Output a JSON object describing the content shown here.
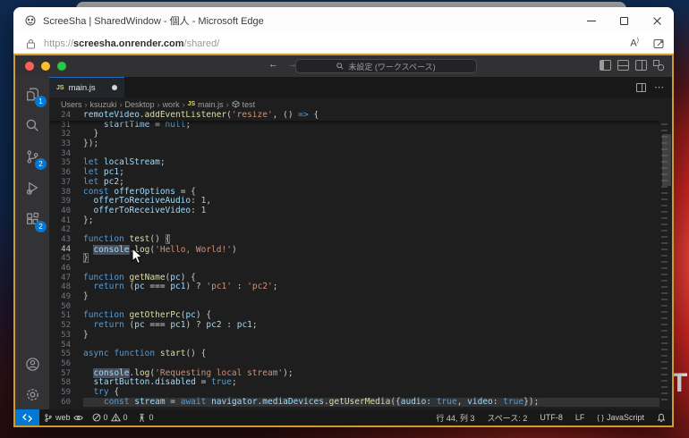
{
  "desktop": {
    "wallpaper_text": "TI"
  },
  "browser": {
    "title": "ScreeSha | SharedWindow - 個人 - Microsoft Edge",
    "url": {
      "protocol": "https://",
      "host": "screesha.onrender.com",
      "path": "/shared/"
    },
    "read_aloud_label": "A"
  },
  "vscode": {
    "traffic_colors": {
      "close": "#ff5f57",
      "minimize": "#febc2e",
      "zoom": "#28c840"
    },
    "command_center": {
      "label": "未設定 (ワークスペース)"
    },
    "tab": {
      "label": "main.js",
      "file_type": "JS"
    },
    "breadcrumb": [
      "Users",
      "ksuzuki",
      "Desktop",
      "work",
      "main.js",
      "test"
    ],
    "breadcrumb_separator": "›",
    "activity_badges": {
      "explorer": "1",
      "source_control": "2",
      "extensions": "2"
    },
    "sticky": {
      "n": "24",
      "t": [
        [
          "v",
          "remoteVideo"
        ],
        [
          "d",
          "."
        ],
        [
          "f",
          "addEventListener"
        ],
        [
          "d",
          "("
        ],
        [
          "s",
          "'resize'"
        ],
        [
          "d",
          ", () "
        ],
        [
          "k",
          "=>"
        ],
        [
          "d",
          " {"
        ]
      ]
    },
    "lines": [
      {
        "n": "31",
        "t": [
          [
            "d",
            "    "
          ],
          [
            "v",
            "startTime"
          ],
          [
            "d",
            " = "
          ],
          [
            "k",
            "null"
          ],
          [
            "d",
            ";"
          ]
        ]
      },
      {
        "n": "32",
        "t": [
          [
            "d",
            "  }"
          ]
        ]
      },
      {
        "n": "33",
        "t": [
          [
            "d",
            "});"
          ]
        ]
      },
      {
        "n": "34",
        "t": []
      },
      {
        "n": "35",
        "t": [
          [
            "k",
            "let"
          ],
          [
            "d",
            " "
          ],
          [
            "v",
            "localStream"
          ],
          [
            "d",
            ";"
          ]
        ]
      },
      {
        "n": "36",
        "t": [
          [
            "k",
            "let"
          ],
          [
            "d",
            " "
          ],
          [
            "v",
            "pc1"
          ],
          [
            "d",
            ";"
          ]
        ]
      },
      {
        "n": "37",
        "t": [
          [
            "k",
            "let"
          ],
          [
            "d",
            " "
          ],
          [
            "v",
            "pc2"
          ],
          [
            "d",
            ";"
          ]
        ]
      },
      {
        "n": "38",
        "t": [
          [
            "k",
            "const"
          ],
          [
            "d",
            " "
          ],
          [
            "v",
            "offerOptions"
          ],
          [
            "d",
            " = {"
          ]
        ]
      },
      {
        "n": "39",
        "t": [
          [
            "d",
            "  "
          ],
          [
            "v",
            "offerToReceiveAudio"
          ],
          [
            "d",
            ": "
          ],
          [
            "n",
            "1"
          ],
          [
            "d",
            ","
          ]
        ]
      },
      {
        "n": "40",
        "t": [
          [
            "d",
            "  "
          ],
          [
            "v",
            "offerToReceiveVideo"
          ],
          [
            "d",
            ": "
          ],
          [
            "n",
            "1"
          ]
        ]
      },
      {
        "n": "41",
        "t": [
          [
            "d",
            "};"
          ]
        ]
      },
      {
        "n": "42",
        "t": []
      },
      {
        "n": "43",
        "t": [
          [
            "k",
            "function"
          ],
          [
            "d",
            " "
          ],
          [
            "f",
            "test"
          ],
          [
            "d",
            "() "
          ],
          [
            "bm",
            "{"
          ]
        ]
      },
      {
        "n": "44",
        "active": true,
        "t": [
          [
            "d",
            "  "
          ],
          [
            "c",
            ""
          ],
          [
            "w",
            "console"
          ],
          [
            "d",
            "."
          ],
          [
            "f",
            "log"
          ],
          [
            "d",
            "("
          ],
          [
            "s",
            "'Hello, World!'"
          ],
          [
            "d",
            ")"
          ]
        ]
      },
      {
        "n": "45",
        "t": [
          [
            "bm",
            "}"
          ]
        ]
      },
      {
        "n": "46",
        "t": []
      },
      {
        "n": "47",
        "t": [
          [
            "k",
            "function"
          ],
          [
            "d",
            " "
          ],
          [
            "f",
            "getName"
          ],
          [
            "d",
            "("
          ],
          [
            "v",
            "pc"
          ],
          [
            "d",
            ") {"
          ]
        ]
      },
      {
        "n": "48",
        "t": [
          [
            "d",
            "  "
          ],
          [
            "k",
            "return"
          ],
          [
            "d",
            " ("
          ],
          [
            "v",
            "pc"
          ],
          [
            "d",
            " "
          ],
          [
            "o",
            "==="
          ],
          [
            "d",
            " "
          ],
          [
            "v",
            "pc1"
          ],
          [
            "d",
            ") ? "
          ],
          [
            "s",
            "'pc1'"
          ],
          [
            "d",
            " : "
          ],
          [
            "s",
            "'pc2'"
          ],
          [
            "d",
            ";"
          ]
        ]
      },
      {
        "n": "49",
        "t": [
          [
            "d",
            "}"
          ]
        ]
      },
      {
        "n": "50",
        "t": []
      },
      {
        "n": "51",
        "t": [
          [
            "k",
            "function"
          ],
          [
            "d",
            " "
          ],
          [
            "f",
            "getOtherPc"
          ],
          [
            "d",
            "("
          ],
          [
            "v",
            "pc"
          ],
          [
            "d",
            ") {"
          ]
        ]
      },
      {
        "n": "52",
        "t": [
          [
            "d",
            "  "
          ],
          [
            "k",
            "return"
          ],
          [
            "d",
            " ("
          ],
          [
            "v",
            "pc"
          ],
          [
            "d",
            " "
          ],
          [
            "o",
            "==="
          ],
          [
            "d",
            " "
          ],
          [
            "v",
            "pc1"
          ],
          [
            "d",
            ") ? "
          ],
          [
            "v",
            "pc2"
          ],
          [
            "d",
            " : "
          ],
          [
            "v",
            "pc1"
          ],
          [
            "d",
            ";"
          ]
        ]
      },
      {
        "n": "53",
        "t": [
          [
            "d",
            "}"
          ]
        ]
      },
      {
        "n": "54",
        "t": []
      },
      {
        "n": "55",
        "t": [
          [
            "k",
            "async"
          ],
          [
            "d",
            " "
          ],
          [
            "k",
            "function"
          ],
          [
            "d",
            " "
          ],
          [
            "f",
            "start"
          ],
          [
            "d",
            "() {"
          ]
        ]
      },
      {
        "n": "56",
        "t": []
      },
      {
        "n": "57",
        "t": [
          [
            "d",
            "  "
          ],
          [
            "w",
            "console"
          ],
          [
            "d",
            "."
          ],
          [
            "f",
            "log"
          ],
          [
            "d",
            "("
          ],
          [
            "s",
            "'Requesting local stream'"
          ],
          [
            "d",
            ");"
          ]
        ]
      },
      {
        "n": "58",
        "t": [
          [
            "d",
            "  "
          ],
          [
            "v",
            "startButton"
          ],
          [
            "d",
            "."
          ],
          [
            "v",
            "disabled"
          ],
          [
            "d",
            " = "
          ],
          [
            "k",
            "true"
          ],
          [
            "d",
            ";"
          ]
        ]
      },
      {
        "n": "59",
        "t": [
          [
            "d",
            "  "
          ],
          [
            "k",
            "try"
          ],
          [
            "d",
            " {"
          ]
        ]
      },
      {
        "n": "60",
        "hl": true,
        "t": [
          [
            "d",
            "    "
          ],
          [
            "k",
            "const"
          ],
          [
            "d",
            " "
          ],
          [
            "v",
            "stream"
          ],
          [
            "d",
            " = "
          ],
          [
            "k",
            "await"
          ],
          [
            "d",
            " "
          ],
          [
            "v",
            "navigator"
          ],
          [
            "d",
            "."
          ],
          [
            "v",
            "mediaDevices"
          ],
          [
            "d",
            "."
          ],
          [
            "f",
            "getUserMedia"
          ],
          [
            "d",
            "({"
          ],
          [
            "v",
            "audio"
          ],
          [
            "d",
            ": "
          ],
          [
            "k",
            "true"
          ],
          [
            "d",
            ", "
          ],
          [
            "v",
            "video"
          ],
          [
            "d",
            ": "
          ],
          [
            "k",
            "true"
          ],
          [
            "d",
            "});"
          ]
        ]
      }
    ],
    "status": {
      "branch": "web",
      "errors": "0",
      "warnings": "0",
      "ports": "0",
      "line_col": "行 44, 列 3",
      "indent": "スペース: 2",
      "encoding": "UTF-8",
      "eol": "LF",
      "lang_icon": "{ }",
      "language": "JavaScript"
    }
  }
}
